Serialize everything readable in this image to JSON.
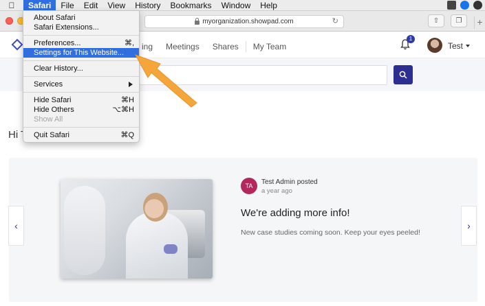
{
  "menubar": {
    "items": [
      "Safari",
      "File",
      "Edit",
      "View",
      "History",
      "Bookmarks",
      "Window",
      "Help"
    ],
    "active": "Safari"
  },
  "toolbar": {
    "url": "myorganization.showpad.com"
  },
  "header": {
    "nav": [
      "ing",
      "Meetings",
      "Shares",
      "My Team"
    ],
    "notification_count": "1",
    "user_name": "Test"
  },
  "greeting": "Hi T",
  "post": {
    "avatar_initials": "TA",
    "author_line": "Test Admin posted",
    "time": "a year ago",
    "title": "We're adding more info!",
    "body": "New case studies coming soon. Keep your eyes peeled!"
  },
  "safari_menu": {
    "about": "About Safari",
    "extensions": "Safari Extensions...",
    "preferences": "Preferences...",
    "preferences_shortcut": "⌘,",
    "settings_site": "Settings for This Website...",
    "clear_history": "Clear History...",
    "services": "Services",
    "hide": "Hide Safari",
    "hide_shortcut": "⌘H",
    "hide_others": "Hide Others",
    "hide_others_shortcut": "⌥⌘H",
    "show_all": "Show All",
    "quit": "Quit Safari",
    "quit_shortcut": "⌘Q"
  },
  "colors": {
    "menu_highlight": "#2f6fe0",
    "brand": "#2c2f8f",
    "annotation_arrow": "#f5a63a",
    "post_avatar": "#b3275c"
  }
}
